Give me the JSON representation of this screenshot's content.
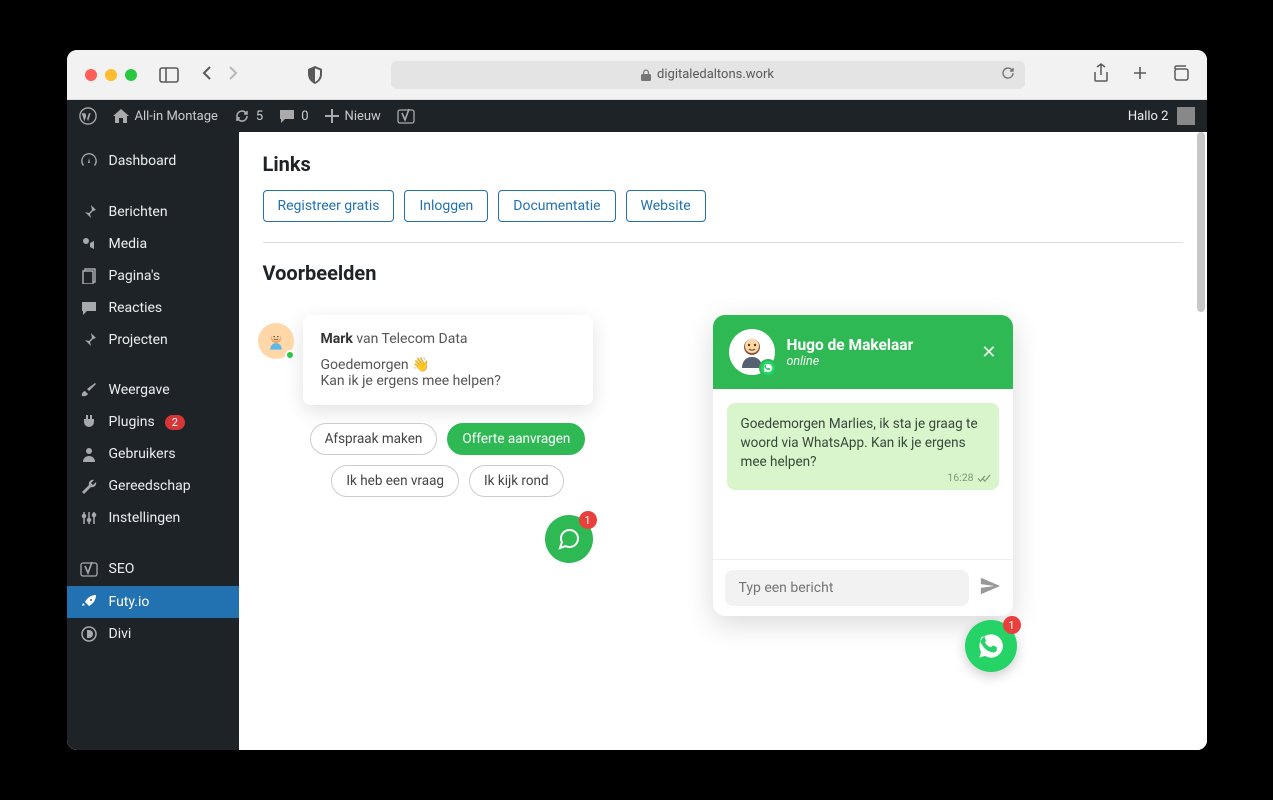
{
  "browser": {
    "url": "digitaledaltons.work"
  },
  "wp_topbar": {
    "site_name": "All-in Montage",
    "updates": "5",
    "comments": "0",
    "new": "Nieuw",
    "greeting": "Hallo 2"
  },
  "sidebar": {
    "items": [
      {
        "label": "Dashboard"
      },
      {
        "label": "Berichten"
      },
      {
        "label": "Media"
      },
      {
        "label": "Pagina's"
      },
      {
        "label": "Reacties"
      },
      {
        "label": "Projecten"
      },
      {
        "label": "Weergave"
      },
      {
        "label": "Plugins",
        "badge": "2"
      },
      {
        "label": "Gebruikers"
      },
      {
        "label": "Gereedschap"
      },
      {
        "label": "Instellingen"
      },
      {
        "label": "SEO"
      },
      {
        "label": "Futy.io",
        "selected": true
      },
      {
        "label": "Divi"
      }
    ]
  },
  "content": {
    "links_heading": "Links",
    "link_buttons": [
      "Registreer gratis",
      "Inloggen",
      "Documentatie",
      "Website"
    ],
    "examples_heading": "Voorbeelden",
    "example1": {
      "sender_bold": "Mark",
      "sender_rest": " van Telecom Data",
      "line1": "Goedemorgen 👋",
      "line2": "Kan ik je ergens mee helpen?",
      "chips": [
        "Afspraak maken",
        "Offerte aanvragen",
        "Ik heb een vraag",
        "Ik kijk rond"
      ],
      "fab_count": "1"
    },
    "example2": {
      "name": "Hugo de Makelaar",
      "status": "online",
      "message": "Goedemorgen Marlies, ik sta je graag te woord via WhatsApp. Kan ik je ergens mee helpen?",
      "time": "16:28",
      "placeholder": "Typ een bericht",
      "fab_count": "1"
    }
  }
}
